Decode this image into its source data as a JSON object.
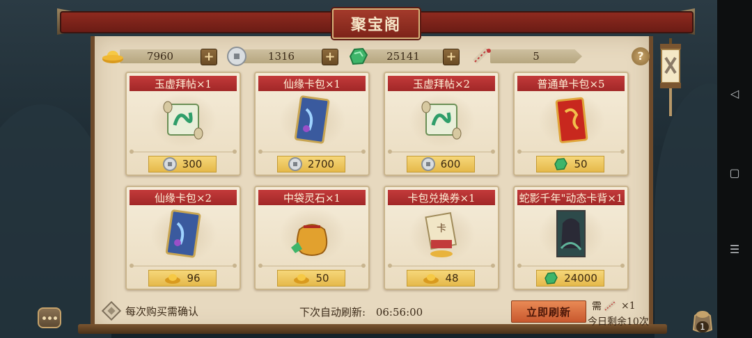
{
  "title": "聚宝阁",
  "currencies": {
    "gold_ingot": "7960",
    "silver_coin": "1316",
    "spirit_stone": "25141",
    "tickets": "5"
  },
  "help_label": "?",
  "items": [
    {
      "name": "玉虚拜帖×1",
      "price": "300",
      "currency": "silver-coin",
      "art": "scroll"
    },
    {
      "name": "仙缘卡包×1",
      "price": "2700",
      "currency": "silver-coin",
      "art": "card-pack"
    },
    {
      "name": "玉虚拜帖×2",
      "price": "600",
      "currency": "silver-coin",
      "art": "scroll"
    },
    {
      "name": "普通单卡包×5",
      "price": "50",
      "currency": "spirit-stone",
      "art": "red-pack"
    },
    {
      "name": "仙缘卡包×2",
      "price": "96",
      "currency": "gold-ingot",
      "art": "card-pack"
    },
    {
      "name": "中袋灵石×1",
      "price": "50",
      "currency": "gold-ingot",
      "art": "bag"
    },
    {
      "name": "卡包兑换券×1",
      "price": "48",
      "currency": "gold-ingot",
      "art": "voucher"
    },
    {
      "name": "蛇影千年\"动态卡背×1",
      "price": "24000",
      "currency": "spirit-stone",
      "art": "card-back"
    }
  ],
  "footer": {
    "confirm_label": "每次购买需确认",
    "auto_refresh_label": "下次自动刷新:",
    "auto_refresh_time": "06:56:00",
    "refresh_button": "立即刷新",
    "need_label": "需",
    "need_count": "×1",
    "remaining": "今日剩余10次"
  },
  "bag_badge": "1",
  "colors": {
    "header_red": "#a12727",
    "price_gold": "#e5b94a",
    "refresh_orange": "#d9693c",
    "panel_parchment": "#e7d9bf"
  }
}
